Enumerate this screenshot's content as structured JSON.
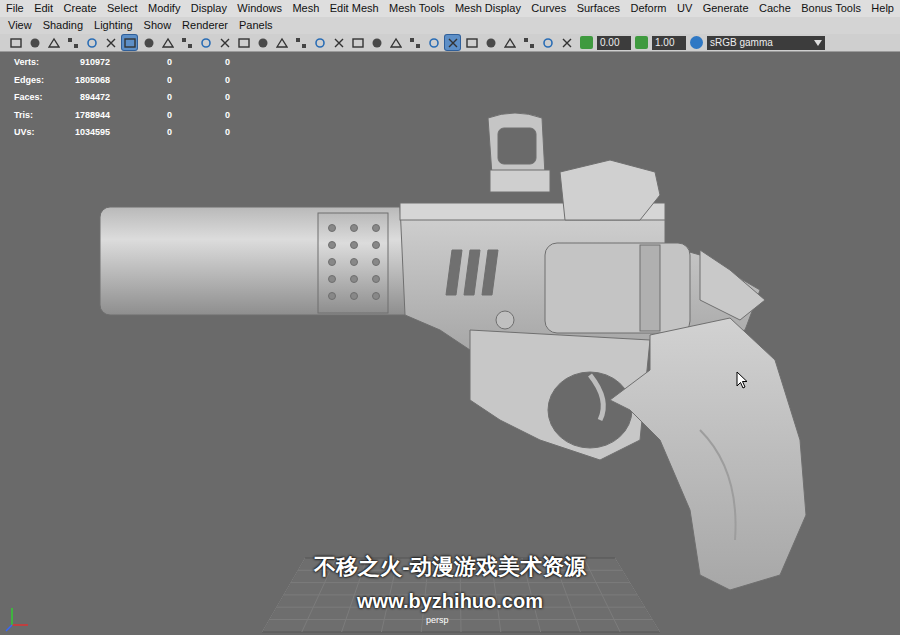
{
  "menu_bar": [
    "File",
    "Edit",
    "Create",
    "Select",
    "Modify",
    "Display",
    "Windows",
    "Mesh",
    "Edit Mesh",
    "Mesh Tools",
    "Mesh Display",
    "Curves",
    "Surfaces",
    "Deform",
    "UV",
    "Generate",
    "Cache",
    "Bonus Tools",
    "Help"
  ],
  "panel_menu": [
    "View",
    "Shading",
    "Lighting",
    "Show",
    "Renderer",
    "Panels"
  ],
  "toolbar": {
    "toggles": [
      {
        "selected": false
      },
      {
        "selected": false
      },
      {
        "selected": false
      },
      {
        "selected": false
      },
      {
        "selected": false
      },
      {
        "selected": false
      },
      {
        "selected": true
      },
      {
        "selected": false
      },
      {
        "selected": false
      },
      {
        "selected": false
      },
      {
        "selected": false
      },
      {
        "selected": false
      },
      {
        "selected": false
      },
      {
        "selected": false
      },
      {
        "selected": false
      },
      {
        "selected": false
      },
      {
        "selected": false
      },
      {
        "selected": false
      },
      {
        "selected": false
      },
      {
        "selected": false
      },
      {
        "selected": false
      },
      {
        "selected": false
      },
      {
        "selected": false
      },
      {
        "selected": true
      },
      {
        "selected": false
      },
      {
        "selected": false
      },
      {
        "selected": false
      },
      {
        "selected": false
      },
      {
        "selected": false
      },
      {
        "selected": false
      }
    ],
    "exposure": "0.00",
    "gamma": "1.00",
    "color_space": "sRGB gamma"
  },
  "hud": [
    {
      "label": "Verts:",
      "values": [
        "910972",
        "0",
        "0"
      ]
    },
    {
      "label": "Edges:",
      "values": [
        "1805068",
        "0",
        "0"
      ]
    },
    {
      "label": "Faces:",
      "values": [
        "894472",
        "0",
        "0"
      ]
    },
    {
      "label": "Tris:",
      "values": [
        "1788944",
        "0",
        "0"
      ]
    },
    {
      "label": "UVs:",
      "values": [
        "1034595",
        "0",
        "0"
      ]
    }
  ],
  "viewport": {
    "camera": "persp"
  },
  "watermark": {
    "title": "不移之火-动漫游戏美术资源",
    "url": "www.byzhihuo.com"
  }
}
